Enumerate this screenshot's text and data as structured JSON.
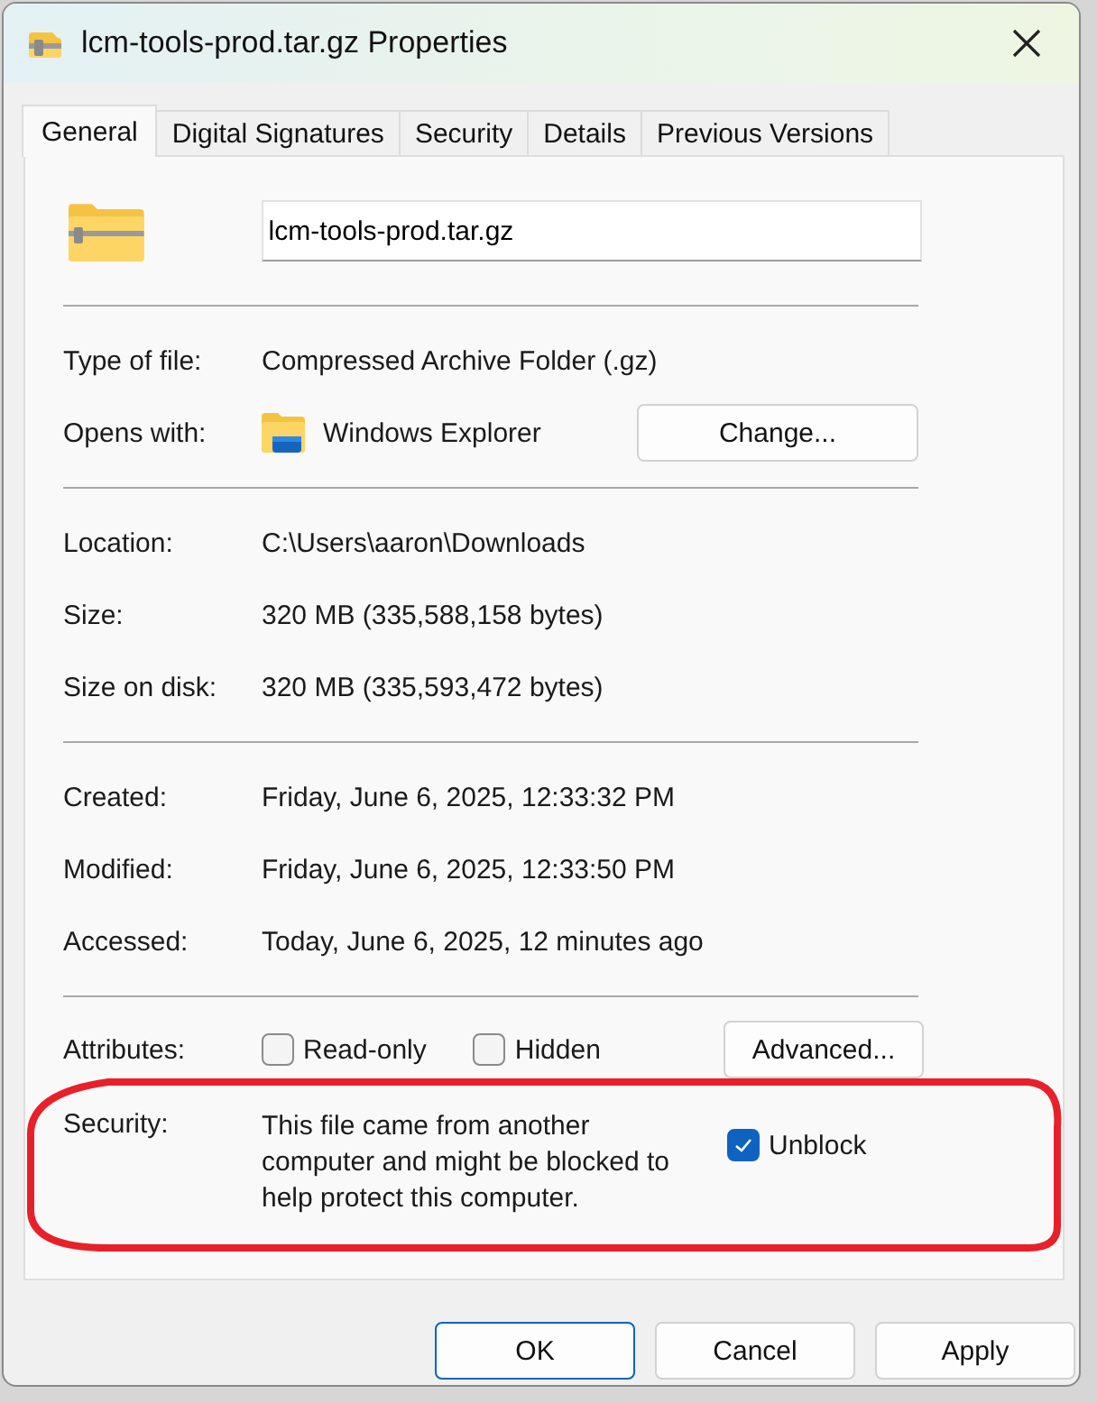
{
  "window": {
    "title": "lcm-tools-prod.tar.gz Properties"
  },
  "tabs": [
    {
      "label": "General",
      "selected": true
    },
    {
      "label": "Digital Signatures",
      "selected": false
    },
    {
      "label": "Security",
      "selected": false
    },
    {
      "label": "Details",
      "selected": false
    },
    {
      "label": "Previous Versions",
      "selected": false
    }
  ],
  "name_field": {
    "value": "lcm-tools-prod.tar.gz"
  },
  "sections": [
    [
      {
        "kind": "text",
        "label": "Type of file:",
        "value": "Compressed Archive Folder (.gz)"
      },
      {
        "kind": "opens",
        "label": "Opens with:",
        "value": "Windows Explorer",
        "button": "Change..."
      }
    ],
    [
      {
        "kind": "text",
        "label": "Location:",
        "value": "C:\\Users\\aaron\\Downloads"
      },
      {
        "kind": "text",
        "label": "Size:",
        "value": "320 MB (335,588,158 bytes)"
      },
      {
        "kind": "text",
        "label": "Size on disk:",
        "value": "320 MB (335,593,472 bytes)"
      }
    ],
    [
      {
        "kind": "text",
        "label": "Created:",
        "value": "Friday, June 6, 2025, 12:33:32 PM"
      },
      {
        "kind": "text",
        "label": "Modified:",
        "value": "Friday, June 6, 2025, 12:33:50 PM"
      },
      {
        "kind": "text",
        "label": "Accessed:",
        "value": "Today, June 6, 2025, 12 minutes ago"
      }
    ],
    [
      {
        "kind": "attributes",
        "label": "Attributes:",
        "checkboxes": [
          {
            "label": "Read-only",
            "checked": false
          },
          {
            "label": "Hidden",
            "checked": false
          }
        ],
        "button": "Advanced..."
      },
      {
        "kind": "security",
        "label": "Security:",
        "value": "This file came from another computer and might be blocked to help protect this computer.",
        "checkbox": {
          "label": "Unblock",
          "checked": true
        }
      }
    ]
  ],
  "buttons": [
    {
      "label": "OK",
      "default": true
    },
    {
      "label": "Cancel",
      "default": false
    },
    {
      "label": "Apply",
      "default": false
    }
  ]
}
